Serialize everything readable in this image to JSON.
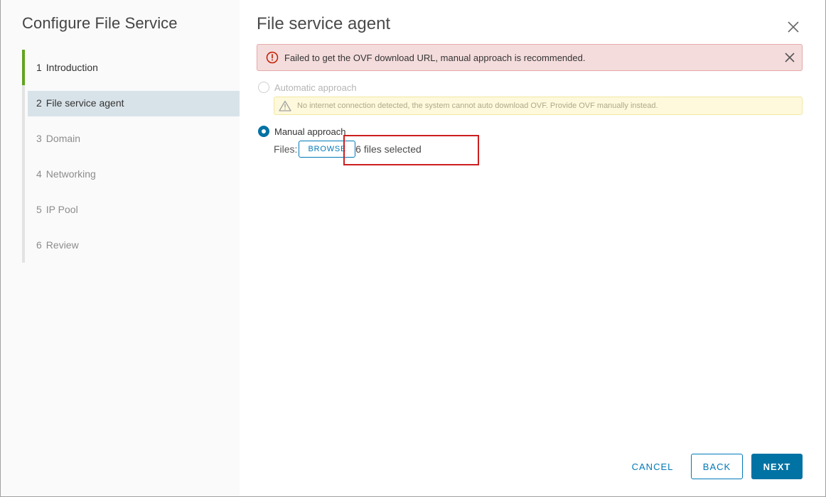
{
  "sidebar": {
    "title": "Configure File Service",
    "steps": [
      {
        "num": "1",
        "label": "Introduction"
      },
      {
        "num": "2",
        "label": "File service agent"
      },
      {
        "num": "3",
        "label": "Domain"
      },
      {
        "num": "4",
        "label": "Networking"
      },
      {
        "num": "5",
        "label": "IP Pool"
      },
      {
        "num": "6",
        "label": "Review"
      }
    ]
  },
  "main": {
    "title": "File service agent",
    "error_alert": "Failed to get the OVF download URL, manual approach is recommended.",
    "automatic_label": "Automatic approach",
    "warning_alert": "No internet connection detected, the system cannot auto download OVF. Provide OVF manually instead.",
    "manual_label": "Manual approach",
    "files_label": "Files:",
    "browse_label": "BROWSE",
    "files_status": "6 files selected"
  },
  "footer": {
    "cancel_label": "CANCEL",
    "back_label": "BACK",
    "next_label": "NEXT"
  },
  "colors": {
    "accent": "#0072a3",
    "progress_green": "#62a420",
    "error_bg": "#f4dcdc",
    "warning_bg": "#fef9dc",
    "highlight_red": "#cc1f1f"
  }
}
